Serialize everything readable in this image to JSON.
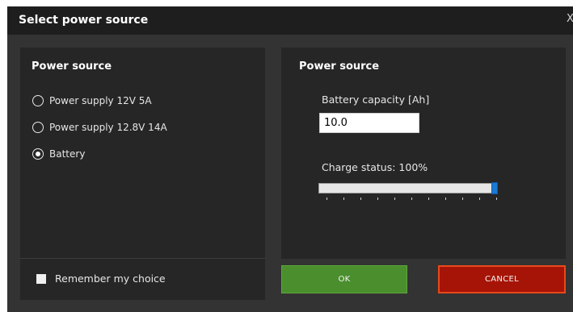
{
  "window": {
    "title": "Select power source",
    "close_label": "X"
  },
  "left_panel": {
    "heading": "Power source",
    "options": [
      {
        "label": "Power supply 12V 5A",
        "selected": false
      },
      {
        "label": "Power supply 12.8V 14A",
        "selected": false
      },
      {
        "label": "Battery",
        "selected": true
      }
    ]
  },
  "right_panel": {
    "heading": "Power source",
    "capacity_label": "Battery capacity [Ah]",
    "capacity_value": "10.0",
    "charge_label": "Charge status: 100%",
    "charge_percent": 100
  },
  "footer": {
    "remember_label": "Remember my choice",
    "remember_checked": false
  },
  "buttons": {
    "ok_label": "OK",
    "cancel_label": "CANCEL"
  },
  "colors": {
    "ok": "#4a8e2d",
    "cancel": "#a61408",
    "slider_thumb": "#1a7ad4"
  }
}
